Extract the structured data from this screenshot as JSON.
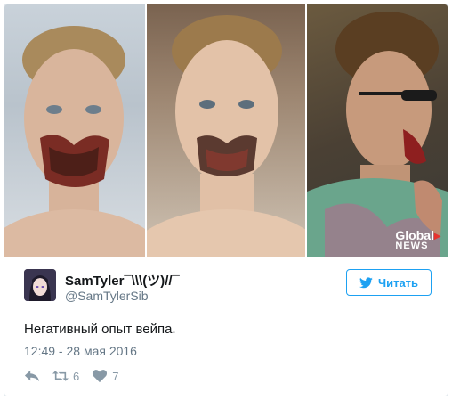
{
  "media": {
    "watermark_logo": "Global NEWS"
  },
  "author": {
    "name": "SamTyler¯\\\\\\(ツ)//¯",
    "handle": "@SamTylerSib"
  },
  "follow_button": {
    "label": "Читать",
    "icon": "twitter-bird-icon"
  },
  "tweet": {
    "text": "Негативный опыт вейпа.",
    "timestamp": "12:49 - 28 мая 2016"
  },
  "actions": {
    "reply": {
      "icon": "reply-icon",
      "count": ""
    },
    "retweet": {
      "icon": "retweet-icon",
      "count": "6"
    },
    "like": {
      "icon": "heart-icon",
      "count": "7"
    }
  },
  "colors": {
    "accent": "#1da1f2",
    "secondary_text": "#657786",
    "border": "#e1e8ed",
    "action_gray": "#8899a6"
  }
}
